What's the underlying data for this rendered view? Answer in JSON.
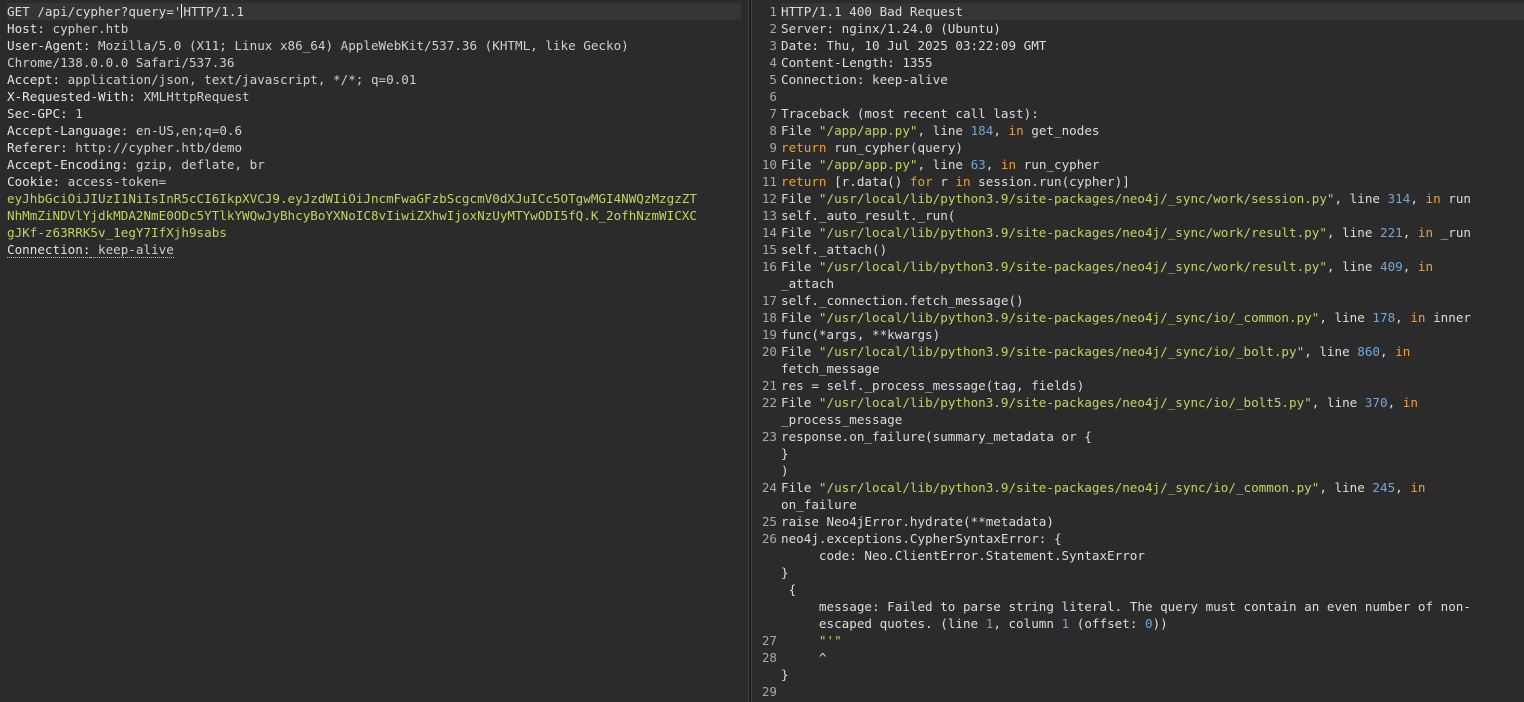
{
  "request": {
    "method_path": "GET /api/cypher?query='",
    "protocol": "HTTP/1.1",
    "headers": [
      {
        "name": "Host:",
        "value": " cypher.htb"
      },
      {
        "name": "User-Agent:",
        "value": " Mozilla/5.0 (X11; Linux x86_64) AppleWebKit/537.36 (KHTML, like Gecko)"
      },
      {
        "name": "",
        "value": "Chrome/138.0.0.0 Safari/537.36"
      },
      {
        "name": "Accept:",
        "value": " application/json, text/javascript, */*; q=0.01"
      },
      {
        "name": "X-Requested-With:",
        "value": " XMLHttpRequest"
      },
      {
        "name": "Sec-GPC:",
        "value": " 1"
      },
      {
        "name": "Accept-Language:",
        "value": " en-US,en;q=0.6"
      },
      {
        "name": "Referer:",
        "value": " http://cypher.htb/demo"
      },
      {
        "name": "Accept-Encoding:",
        "value": " gzip, deflate, br"
      },
      {
        "name": "Cookie:",
        "value": " access-token="
      }
    ],
    "cookie_lines": [
      "eyJhbGciOiJIUzI1NiIsInR5cCI6IkpXVCJ9.eyJzdWIiOiJncmFwaGFzbScgcmV0dXJuICc5OTgwMGI4NWQzMzgzZT",
      "NhMmZiNDVlYjdkMDA2NmE0ODc5YTlkYWQwJyBhcyBoYXNoIC8vIiwiZXhwIjoxNzUyMTYwODI5fQ.K_2ofhNzmWICXC",
      "gJKf-z63RRK5v_1egY7IfXjh9sabs"
    ],
    "connection_name": "Connection:",
    "connection_value": " keep-alive"
  },
  "response": {
    "lines": [
      {
        "n": "1",
        "t": "HTTP/1.1 400 Bad Request"
      },
      {
        "n": "2",
        "t": "Server: nginx/1.24.0 (Ubuntu)"
      },
      {
        "n": "3",
        "t": "Date: Thu, 10 Jul 2025 03:22:09 GMT"
      },
      {
        "n": "4",
        "t": "Content-Length: 1355"
      },
      {
        "n": "5",
        "t": "Connection: keep-alive"
      },
      {
        "n": "6",
        "t": ""
      },
      {
        "n": "7",
        "t": "Traceback (most recent call last):"
      },
      {
        "n": "8",
        "t": "File \"/app/app.py\", line 184, in get_nodes"
      },
      {
        "n": "9",
        "t": "return run_cypher(query)"
      },
      {
        "n": "10",
        "t": "File \"/app/app.py\", line 63, in run_cypher"
      },
      {
        "n": "11",
        "t": "return [r.data() for r in session.run(cypher)]"
      },
      {
        "n": "12",
        "t": "File \"/usr/local/lib/python3.9/site-packages/neo4j/_sync/work/session.py\", line 314, in run"
      },
      {
        "n": "13",
        "t": "self._auto_result._run("
      },
      {
        "n": "14",
        "t": "File \"/usr/local/lib/python3.9/site-packages/neo4j/_sync/work/result.py\", line 221, in _run"
      },
      {
        "n": "15",
        "t": "self._attach()"
      },
      {
        "n": "16",
        "t": "File \"/usr/local/lib/python3.9/site-packages/neo4j/_sync/work/result.py\", line 409, in"
      },
      {
        "n": "",
        "t": "_attach"
      },
      {
        "n": "17",
        "t": "self._connection.fetch_message()"
      },
      {
        "n": "18",
        "t": "File \"/usr/local/lib/python3.9/site-packages/neo4j/_sync/io/_common.py\", line 178, in inner"
      },
      {
        "n": "19",
        "t": "func(*args, **kwargs)"
      },
      {
        "n": "20",
        "t": "File \"/usr/local/lib/python3.9/site-packages/neo4j/_sync/io/_bolt.py\", line 860, in"
      },
      {
        "n": "",
        "t": "fetch_message"
      },
      {
        "n": "21",
        "t": "res = self._process_message(tag, fields)"
      },
      {
        "n": "22",
        "t": "File \"/usr/local/lib/python3.9/site-packages/neo4j/_sync/io/_bolt5.py\", line 370, in"
      },
      {
        "n": "",
        "t": "_process_message"
      },
      {
        "n": "23",
        "t": "response.on_failure(summary_metadata or {"
      },
      {
        "n": "",
        "t": "}"
      },
      {
        "n": "",
        "t": ")"
      },
      {
        "n": "24",
        "t": "File \"/usr/local/lib/python3.9/site-packages/neo4j/_sync/io/_common.py\", line 245, in"
      },
      {
        "n": "",
        "t": "on_failure"
      },
      {
        "n": "25",
        "t": "raise Neo4jError.hydrate(**metadata)"
      },
      {
        "n": "26",
        "t": "neo4j.exceptions.CypherSyntaxError: {"
      },
      {
        "n": "",
        "t": "     code: Neo.ClientError.Statement.SyntaxError"
      },
      {
        "n": "",
        "t": "}"
      },
      {
        "n": "",
        "t": " {"
      },
      {
        "n": "",
        "t": "     message: Failed to parse string literal. The query must contain an even number of non-"
      },
      {
        "n": "",
        "t": "     escaped quotes. (line 1, column 1 (offset: 0))"
      },
      {
        "n": "27",
        "t": "     \"'\""
      },
      {
        "n": "28",
        "t": "     ^"
      },
      {
        "n": "",
        "t": "}"
      },
      {
        "n": "29",
        "t": ""
      }
    ]
  }
}
